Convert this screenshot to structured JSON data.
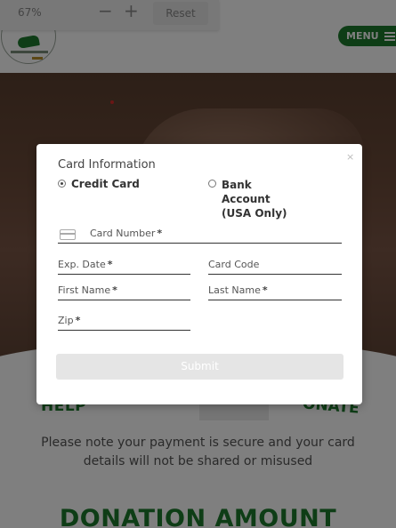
{
  "zoom_bar": {
    "percent": "67%",
    "minus": "−",
    "plus": "+",
    "reset": "Reset"
  },
  "header": {
    "menu_label": "MENU"
  },
  "page": {
    "help_left": "HELP",
    "help_right": "ONATE",
    "secure_note": "Please note your payment is secure and your card details will not be shared or misused",
    "donation_title": "DONATION AMOUNT"
  },
  "modal": {
    "close": "×",
    "title": "Card Information",
    "payment_options": [
      {
        "label": "Credit Card",
        "selected": true
      },
      {
        "label": "Bank Account (USA Only)",
        "selected": false
      }
    ],
    "fields": {
      "card_number": "Card Number",
      "exp_date": "Exp. Date",
      "card_code": "Card Code",
      "first_name": "First Name",
      "last_name": "Last Name",
      "zip": "Zip"
    },
    "required_mark": "*",
    "submit": "Submit"
  },
  "colors": {
    "brand_green": "#1c7a2c",
    "overlay": "rgba(0,0,0,0.5)",
    "submit_bg": "#e5e5e5"
  }
}
